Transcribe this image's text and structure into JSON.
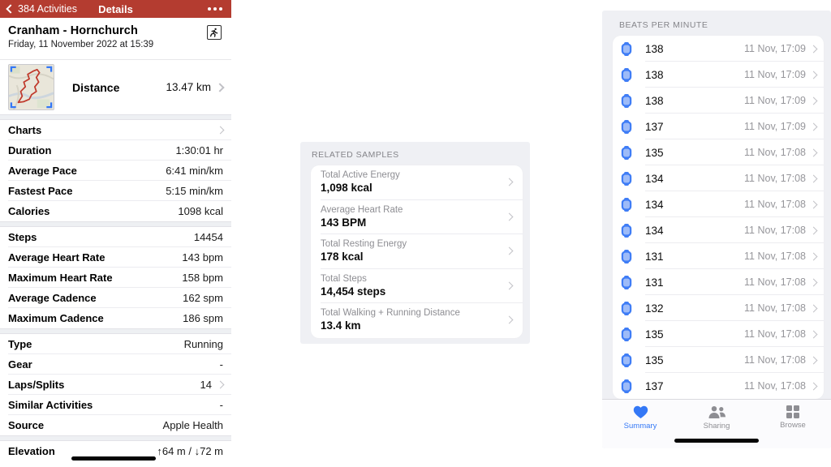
{
  "left_panel": {
    "nav": {
      "back_label": "384 Activities",
      "title": "Details"
    },
    "header": {
      "title": "Cranham - Hornchurch",
      "subtitle": "Friday, 11 November 2022 at 15:39"
    },
    "distance_row": {
      "label": "Distance",
      "value": "13.47 km"
    },
    "groups": [
      {
        "rows": [
          {
            "label": "Charts",
            "value": ""
          },
          {
            "label": "Duration",
            "value": "1:30:01 hr"
          },
          {
            "label": "Average Pace",
            "value": "6:41 min/km"
          },
          {
            "label": "Fastest Pace",
            "value": "5:15 min/km"
          },
          {
            "label": "Calories",
            "value": "1098 kcal"
          }
        ]
      },
      {
        "rows": [
          {
            "label": "Steps",
            "value": "14454"
          },
          {
            "label": "Average Heart Rate",
            "value": "143 bpm"
          },
          {
            "label": "Maximum Heart Rate",
            "value": "158 bpm"
          },
          {
            "label": "Average Cadence",
            "value": "162 spm"
          },
          {
            "label": "Maximum Cadence",
            "value": "186 spm"
          }
        ]
      },
      {
        "rows": [
          {
            "label": "Type",
            "value": "Running"
          },
          {
            "label": "Gear",
            "value": "-"
          },
          {
            "label": "Laps/Splits",
            "value": "14"
          },
          {
            "label": "Similar Activities",
            "value": "-"
          },
          {
            "label": "Source",
            "value": "Apple Health"
          }
        ]
      },
      {
        "rows": [
          {
            "label": "Elevation",
            "value": "↑64 m / ↓72 m"
          }
        ]
      }
    ]
  },
  "related_samples": {
    "section_title": "RELATED SAMPLES",
    "items": [
      {
        "label": "Total Active Energy",
        "value": "1,098 kcal"
      },
      {
        "label": "Average Heart Rate",
        "value": "143 BPM"
      },
      {
        "label": "Total Resting Energy",
        "value": "178 kcal"
      },
      {
        "label": "Total Steps",
        "value": "14,454 steps"
      },
      {
        "label": "Total Walking + Running Distance",
        "value": "13.4 km"
      }
    ]
  },
  "heart_rate_panel": {
    "section_title": "BEATS PER MINUTE",
    "samples": [
      {
        "value": "138",
        "time": "11 Nov, 17:09"
      },
      {
        "value": "138",
        "time": "11 Nov, 17:09"
      },
      {
        "value": "138",
        "time": "11 Nov, 17:09"
      },
      {
        "value": "137",
        "time": "11 Nov, 17:09"
      },
      {
        "value": "135",
        "time": "11 Nov, 17:08"
      },
      {
        "value": "134",
        "time": "11 Nov, 17:08"
      },
      {
        "value": "134",
        "time": "11 Nov, 17:08"
      },
      {
        "value": "134",
        "time": "11 Nov, 17:08"
      },
      {
        "value": "131",
        "time": "11 Nov, 17:08"
      },
      {
        "value": "131",
        "time": "11 Nov, 17:08"
      },
      {
        "value": "132",
        "time": "11 Nov, 17:08"
      },
      {
        "value": "135",
        "time": "11 Nov, 17:08"
      },
      {
        "value": "135",
        "time": "11 Nov, 17:08"
      },
      {
        "value": "137",
        "time": "11 Nov, 17:08"
      }
    ],
    "tab_bar": {
      "tabs": [
        {
          "label": "Summary",
          "icon": "heart-icon",
          "active": true
        },
        {
          "label": "Sharing",
          "icon": "people-icon",
          "active": false
        },
        {
          "label": "Browse",
          "icon": "grid-icon",
          "active": false
        }
      ]
    }
  },
  "colors": {
    "nav_red": "#b43c30",
    "accent_blue": "#3478f6",
    "route_red": "#c0392b"
  }
}
